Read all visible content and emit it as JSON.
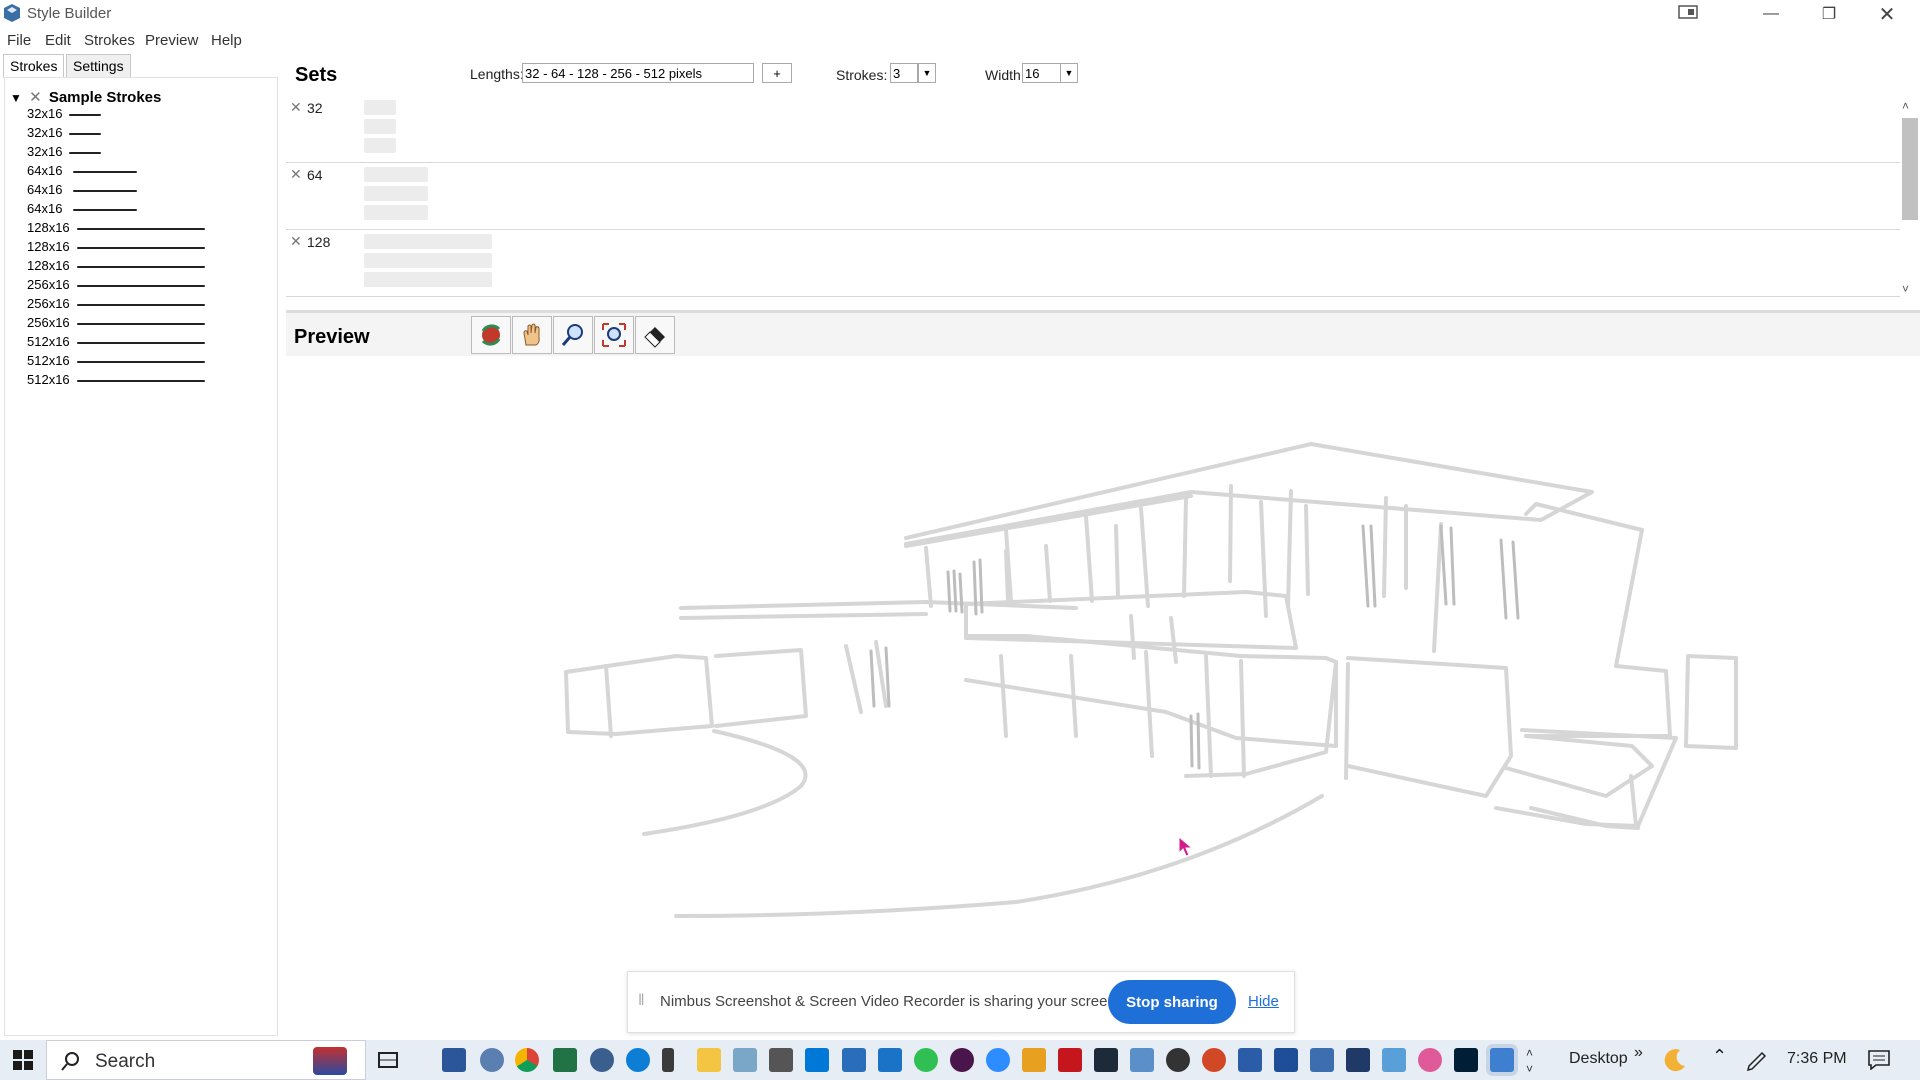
{
  "window": {
    "title": "Style Builder",
    "controls": [
      "minimize",
      "restore",
      "close"
    ]
  },
  "menu": [
    "File",
    "Edit",
    "Strokes",
    "Preview",
    "Help"
  ],
  "left_tabs": [
    {
      "label": "Strokes",
      "active": true
    },
    {
      "label": "Settings",
      "active": false
    }
  ],
  "tree": {
    "root_label": "Sample Strokes",
    "items": [
      {
        "label": "32x16",
        "length": 32
      },
      {
        "label": "32x16",
        "length": 32
      },
      {
        "label": "32x16",
        "length": 32
      },
      {
        "label": "64x16",
        "length": 64
      },
      {
        "label": "64x16",
        "length": 64
      },
      {
        "label": "64x16",
        "length": 64
      },
      {
        "label": "128x16",
        "length": 128
      },
      {
        "label": "128x16",
        "length": 128
      },
      {
        "label": "128x16",
        "length": 128
      },
      {
        "label": "256x16",
        "length": 256
      },
      {
        "label": "256x16",
        "length": 256
      },
      {
        "label": "256x16",
        "length": 256
      },
      {
        "label": "512x16",
        "length": 512
      },
      {
        "label": "512x16",
        "length": 512
      },
      {
        "label": "512x16",
        "length": 512
      }
    ]
  },
  "sets": {
    "title": "Sets",
    "lengths_label": "Lengths:",
    "lengths_value": "32 - 64 - 128 - 256 - 512 pixels",
    "add_label": "+",
    "strokes_label": "Strokes:",
    "strokes_value": "3",
    "width_label": "Width:",
    "width_value": "16",
    "rows": [
      {
        "label": "32"
      },
      {
        "label": "64"
      },
      {
        "label": "128"
      }
    ]
  },
  "preview": {
    "title": "Preview",
    "tools": [
      "orbit-icon",
      "pan-icon",
      "zoom-icon",
      "zoom-extents-icon",
      "eraser-icon"
    ]
  },
  "share_banner": {
    "message": "Nimbus Screenshot & Screen Video Recorder is sharing your screen.",
    "stop_label": "Stop sharing",
    "hide_label": "Hide"
  },
  "taskbar": {
    "search_placeholder": "Search",
    "desktop_label": "Desktop",
    "time": "7:36 PM"
  },
  "colors": {
    "accent": "#1f6fd8"
  }
}
